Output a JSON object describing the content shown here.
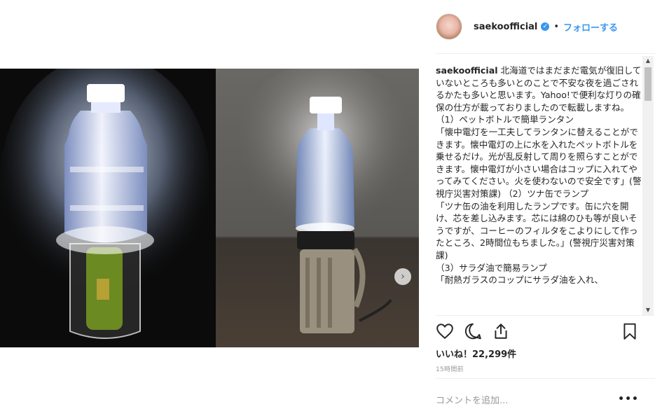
{
  "post": {
    "username": "saekoofficial",
    "verified_icon": "verified-badge-icon",
    "separator": "•",
    "follow_label": "フォローする",
    "next_icon": "chevron-right-icon",
    "next_glyph": "›"
  },
  "caption": {
    "author": "saekoofficial",
    "text": " 北海道ではまだまだ電気が復旧していないところも多いとのことで不安な夜を過ごされるかたも多いと思います。Yahoo!で便利な灯りの確保の仕方が載っておりましたので転載しますね。 （1）ペットボトルで簡単ランタン\n「懐中電灯を一工夫してランタンに替えることができます。懐中電灯の上に水を入れたペットボトルを乗せるだけ。光が乱反射して周りを照らすことができます。懐中電灯が小さい場合はコップに入れてやってみてください。火を使わないので安全です」(警視庁災害対策課) （2）ツナ缶でランプ\n「ツナ缶の油を利用したランプです。缶に穴を開け、芯を差し込みます。芯には綿のひも等が良いそうですが、コーヒーのフィルタをこよりにして作ったところ、2時間位もちました。」(警視庁災害対策課)\n（3）サラダ油で簡易ランプ\n「耐熱ガラスのコップにサラダ油を入れ、"
  },
  "scrollbar": {
    "up_glyph": "▲",
    "down_glyph": "▼"
  },
  "actions": {
    "like_icon": "heart-icon",
    "comment_icon": "comment-icon",
    "share_icon": "share-icon",
    "save_icon": "bookmark-icon"
  },
  "likes_text": "いいね！22,299件",
  "timestamp": "15時間前",
  "comment": {
    "placeholder": "コメントを追加...",
    "more_label": "•••"
  },
  "colors": {
    "accent": "#3897f0",
    "text": "#262626",
    "muted": "#999999",
    "divider": "#efefef"
  }
}
